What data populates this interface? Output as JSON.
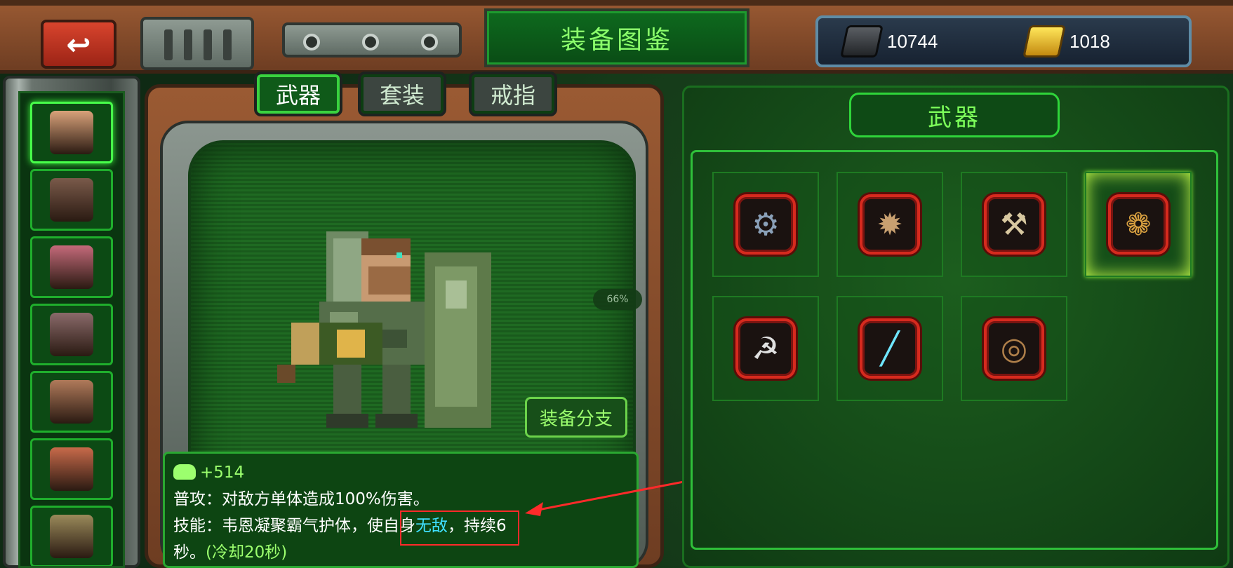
{
  "header": {
    "title": "装备图鉴",
    "currency": [
      {
        "icon": "iron-ingot-icon",
        "value": "10744"
      },
      {
        "icon": "gold-ingot-icon",
        "value": "1018"
      }
    ]
  },
  "tabs": [
    {
      "label": "武器",
      "active": true
    },
    {
      "label": "套装",
      "active": false
    },
    {
      "label": "戒指",
      "active": false
    }
  ],
  "heroes": [
    {
      "name": "hero-1",
      "active": true,
      "color": "#d9a27a"
    },
    {
      "name": "hero-2",
      "active": false,
      "color": "#7a5a4a"
    },
    {
      "name": "hero-3",
      "active": false,
      "color": "#c46a7a"
    },
    {
      "name": "hero-4",
      "active": false,
      "color": "#8a6a6a"
    },
    {
      "name": "hero-5",
      "active": false,
      "color": "#b07a5a"
    },
    {
      "name": "hero-6",
      "active": false,
      "color": "#c86a4a"
    },
    {
      "name": "hero-7",
      "active": false,
      "color": "#9a8a5a"
    }
  ],
  "preview": {
    "zoom": "66%",
    "branch_button": "装备分支"
  },
  "description": {
    "stat": "+514",
    "line1": "普攻：对敌方单体造成100%伤害。",
    "line2_pre": "技能：韦恩凝聚霸气护体，",
    "line2_hl_pre": "使自身",
    "line2_hl_cyan": "无敌",
    "line2_hl_post": "，",
    "line2_post": "持续6",
    "line3_pre": "秒。",
    "line3_cd": "(冷却20秒)"
  },
  "weapons_panel": {
    "title": "武器",
    "items": [
      {
        "icon": "cannon-gun-icon",
        "selected": false
      },
      {
        "icon": "spiked-mace-icon",
        "selected": false
      },
      {
        "icon": "battle-axe-icon",
        "selected": false
      },
      {
        "icon": "torch-club-icon",
        "selected": true
      },
      {
        "icon": "scythe-icon",
        "selected": false
      },
      {
        "icon": "lightsaber-icon",
        "selected": false
      },
      {
        "icon": "hand-cannon-icon",
        "selected": false
      }
    ]
  },
  "colors": {
    "accent_green": "#47ff4a",
    "annotation_red": "#ff2a2a",
    "highlight_cyan": "#3fe0ff"
  }
}
